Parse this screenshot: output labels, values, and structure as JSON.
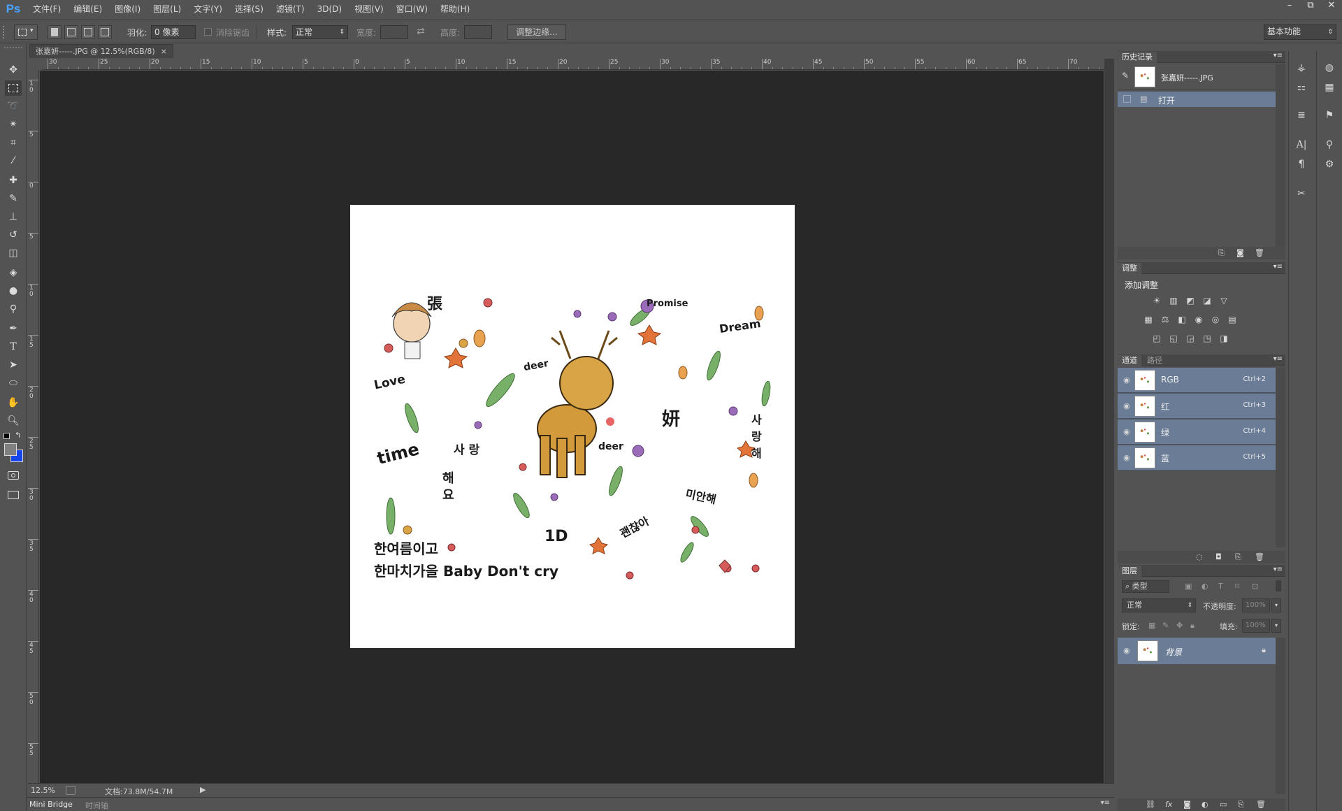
{
  "app": {
    "logo": "Ps"
  },
  "menu": [
    "文件(F)",
    "编辑(E)",
    "图像(I)",
    "图层(L)",
    "文字(Y)",
    "选择(S)",
    "滤镜(T)",
    "3D(D)",
    "视图(V)",
    "窗口(W)",
    "帮助(H)"
  ],
  "window_controls": [
    "–",
    "⧉",
    "✕"
  ],
  "options": {
    "feather_label": "羽化:",
    "feather_value": "0 像素",
    "antialias_label": "消除锯齿",
    "style_label": "样式:",
    "style_value": "正常",
    "width_label": "宽度:",
    "height_label": "高度:",
    "refine_button": "调整边缘...",
    "workspace": "基本功能"
  },
  "document": {
    "tab_title": "张嘉妍-----.JPG @ 12.5%(RGB/8)",
    "close": "×",
    "zoom": "12.5%",
    "doc_info": "文档:73.8M/54.7M"
  },
  "ruler": {
    "top_labels": [
      "30",
      "25",
      "20",
      "15",
      "10",
      "5",
      "0",
      "5",
      "10",
      "15",
      "20",
      "25",
      "30",
      "35",
      "40",
      "45",
      "50",
      "55",
      "60",
      "65",
      "70"
    ],
    "left_labels": [
      "1 0",
      "5",
      "0",
      "5",
      "1 0",
      "1 5",
      "2 0",
      "2 5",
      "3 0",
      "3 5",
      "4 0",
      "4 5",
      "5 0",
      "5 5"
    ]
  },
  "artwork": {
    "texts": [
      "張",
      "Promise",
      "Dream",
      "Love",
      "deer",
      "time",
      "사 랑",
      "해 요",
      "deer",
      "妍",
      "사 랑 해",
      "미안해",
      "괜찮아",
      "1D",
      "한여름이고",
      "한마치가을 Baby Don't cry"
    ]
  },
  "bottom": {
    "tabs": [
      "Mini Bridge",
      "时间轴"
    ]
  },
  "history": {
    "tab": "历史记录",
    "snapshot": "张嘉妍-----.JPG",
    "items": [
      {
        "label": "打开"
      }
    ]
  },
  "adjustments": {
    "tab": "调整",
    "title": "添加调整",
    "row1": [
      "☀",
      "▥",
      "◩",
      "◪",
      "▽"
    ],
    "row2": [
      "▦",
      "⚖",
      "◧",
      "◉",
      "◎",
      "▤"
    ],
    "row3": [
      "◰",
      "◱",
      "◲",
      "◳",
      "◨"
    ]
  },
  "channels": {
    "tabs": [
      "通道",
      "路径"
    ],
    "rows": [
      {
        "name": "RGB",
        "shortcut": "Ctrl+2"
      },
      {
        "name": "红",
        "shortcut": "Ctrl+3"
      },
      {
        "name": "绿",
        "shortcut": "Ctrl+4"
      },
      {
        "name": "蓝",
        "shortcut": "Ctrl+5"
      }
    ]
  },
  "layers": {
    "tab": "图层",
    "filter_label": "类型",
    "blend_mode": "正常",
    "opacity_label": "不透明度:",
    "opacity_value": "100%",
    "lock_label": "锁定:",
    "fill_label": "填充:",
    "fill_value": "100%",
    "items": [
      {
        "name": "背景"
      }
    ]
  },
  "colors": {
    "foreground": "#808080",
    "background": "#1646e8",
    "selection": "#6a7c96",
    "canvas_bg": "#282828",
    "ui_bg": "#535353"
  }
}
